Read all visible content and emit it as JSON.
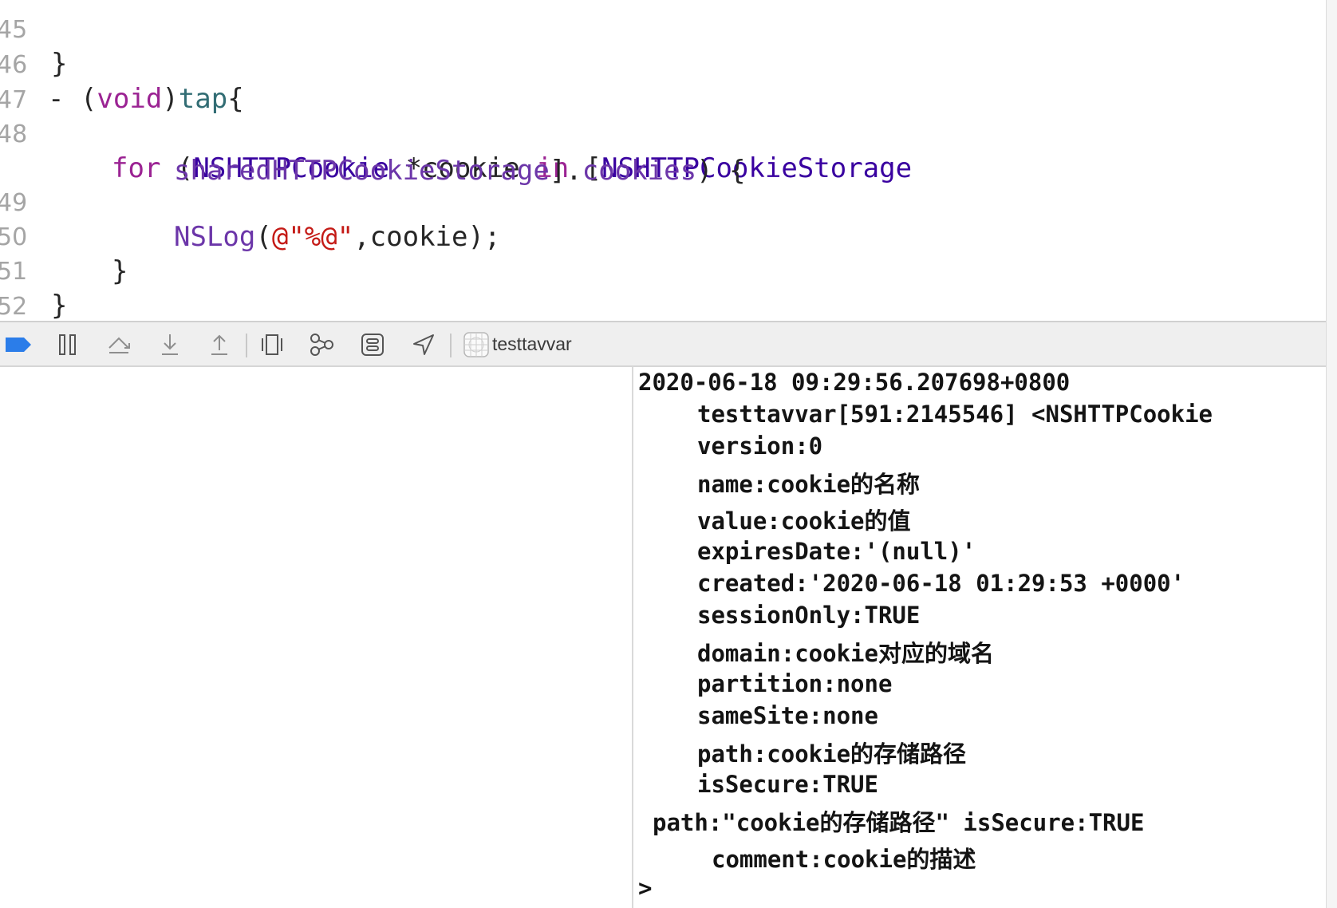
{
  "editor": {
    "lines": [
      {
        "no": "45",
        "tokens": [
          {
            "t": "}",
            "c": ""
          }
        ]
      },
      {
        "no": "46",
        "tokens": [
          {
            "t": "- (",
            "c": ""
          },
          {
            "t": "void",
            "c": "kw"
          },
          {
            "t": ")",
            "c": ""
          },
          {
            "t": "tap",
            "c": "fn"
          },
          {
            "t": "{",
            "c": ""
          }
        ]
      },
      {
        "no": "47",
        "tokens": []
      },
      {
        "no": "48",
        "tokens": [
          {
            "t": "for",
            "c": "kw"
          },
          {
            "t": " (",
            "c": ""
          },
          {
            "t": "NSHTTPCookie",
            "c": "cls"
          },
          {
            "t": " *cookie ",
            "c": ""
          },
          {
            "t": "in",
            "c": "kw"
          },
          {
            "t": " [",
            "c": ""
          },
          {
            "t": "NSHTTPCookieStorage",
            "c": "cls"
          }
        ]
      },
      {
        "no": "",
        "tokens": [
          {
            "t": "sharedHTTPCookieStorage",
            "c": "prop"
          },
          {
            "t": "].",
            "c": ""
          },
          {
            "t": "cookies",
            "c": "prop"
          },
          {
            "t": ") {",
            "c": ""
          }
        ]
      },
      {
        "no": "49",
        "tokens": [
          {
            "t": "NSLog",
            "c": "fnc"
          },
          {
            "t": "(",
            "c": ""
          },
          {
            "t": "@\"%@\"",
            "c": "str"
          },
          {
            "t": ",cookie);",
            "c": ""
          }
        ]
      },
      {
        "no": "50",
        "tokens": [
          {
            "t": "}",
            "c": ""
          }
        ]
      },
      {
        "no": "51",
        "tokens": [
          {
            "t": "}",
            "c": ""
          }
        ]
      },
      {
        "no": "52",
        "tokens": []
      }
    ]
  },
  "toolbar": {
    "icons": [
      "breakpoint-toggle-icon",
      "pause-continue-icon",
      "step-over-icon",
      "step-into-icon",
      "step-out-icon",
      "view-hierarchy-icon",
      "memory-graph-icon",
      "environment-overrides-icon",
      "simulate-location-icon"
    ],
    "target_label": "testtavvar"
  },
  "console": {
    "lines": [
      "2020-06-18 09:29:56.207698+0800",
      "testtavvar[591:2145546] <NSHTTPCookie",
      "version:0",
      "name:cookie的名称",
      "value:cookie的值",
      "expiresDate:'(null)'",
      "created:'2020-06-18 01:29:53 +0000'",
      "sessionOnly:TRUE",
      "domain:cookie对应的域名",
      "partition:none",
      "sameSite:none",
      "path:cookie的存储路径",
      "isSecure:TRUE",
      "path:\"cookie的存储路径\" isSecure:TRUE",
      "comment:cookie的描述",
      ">"
    ]
  },
  "colors": {
    "keyword": "#9b2393",
    "class": "#3900a0",
    "function": "#326d74",
    "property": "#6c36a9",
    "string": "#c41a16",
    "breakpoint": "#2b7de9"
  }
}
